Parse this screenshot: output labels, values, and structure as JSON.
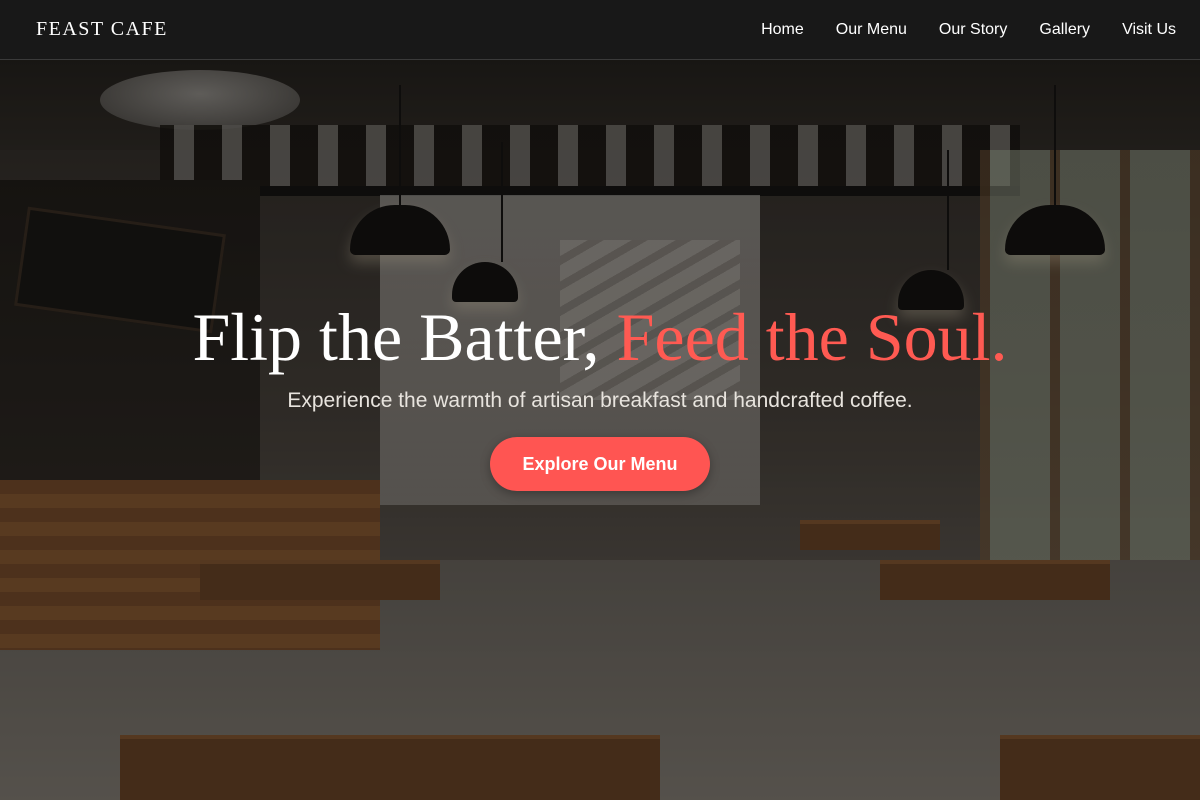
{
  "brand": {
    "name": "FEAST CAFE"
  },
  "nav": {
    "items": [
      "Home",
      "Our Menu",
      "Our Story",
      "Gallery",
      "Visit Us"
    ]
  },
  "hero": {
    "headline_part1": "Flip the Batter, ",
    "headline_part2": "Feed the Soul.",
    "subheadline": "Experience the warmth of artisan breakfast and handcrafted coffee.",
    "cta_label": "Explore Our Menu"
  },
  "colors": {
    "accent": "#ff5552",
    "navbar_bg": "#181818",
    "text": "#ffffff"
  }
}
